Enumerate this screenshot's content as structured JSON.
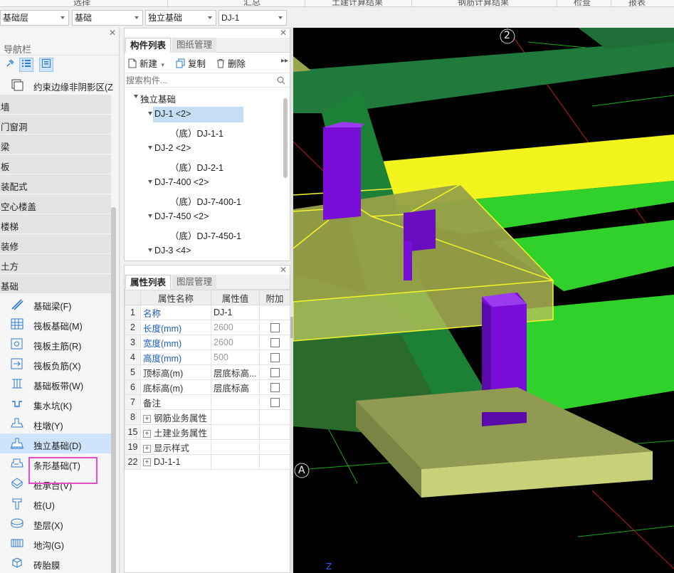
{
  "ribbon": {
    "items": [
      "选择",
      "汇总",
      "土建计算结果",
      "钢筋计算结果",
      "检查",
      "报表"
    ]
  },
  "selectors": [
    {
      "value": "基础层"
    },
    {
      "value": "基础"
    },
    {
      "value": "独立基础"
    },
    {
      "value": "DJ-1"
    }
  ],
  "nav": {
    "title": "导航栏",
    "items": [
      {
        "kind": "item",
        "label": "约束边缘非阴影区(Z",
        "icon": "wall-edge-icon"
      },
      {
        "kind": "cat",
        "label": "墙"
      },
      {
        "kind": "cat",
        "label": "门窗洞"
      },
      {
        "kind": "cat",
        "label": "梁"
      },
      {
        "kind": "cat",
        "label": "板"
      },
      {
        "kind": "cat",
        "label": "装配式"
      },
      {
        "kind": "cat",
        "label": "空心楼盖"
      },
      {
        "kind": "cat",
        "label": "楼梯"
      },
      {
        "kind": "cat",
        "label": "装修"
      },
      {
        "kind": "cat",
        "label": "土方"
      },
      {
        "kind": "cat",
        "label": "基础"
      },
      {
        "kind": "item",
        "label": "基础梁(F)",
        "icon": "foundation-beam-icon"
      },
      {
        "kind": "item",
        "label": "筏板基础(M)",
        "icon": "raft-foundation-icon"
      },
      {
        "kind": "item",
        "label": "筏板主筋(R)",
        "icon": "raft-main-rebar-icon"
      },
      {
        "kind": "item",
        "label": "筏板负筋(X)",
        "icon": "raft-negative-rebar-icon"
      },
      {
        "kind": "item",
        "label": "基础板带(W)",
        "icon": "foundation-strip-icon"
      },
      {
        "kind": "item",
        "label": "集水坑(K)",
        "icon": "sump-pit-icon"
      },
      {
        "kind": "item",
        "label": "柱墩(Y)",
        "icon": "column-pier-icon"
      },
      {
        "kind": "item",
        "label": "独立基础(D)",
        "icon": "isolated-footing-icon",
        "selected": true
      },
      {
        "kind": "item",
        "label": "条形基础(T)",
        "icon": "strip-footing-icon"
      },
      {
        "kind": "item",
        "label": "桩承台(V)",
        "icon": "pile-cap-icon"
      },
      {
        "kind": "item",
        "label": "桩(U)",
        "icon": "pile-icon"
      },
      {
        "kind": "item",
        "label": "垫层(X)",
        "icon": "cushion-icon"
      },
      {
        "kind": "item",
        "label": "地沟(G)",
        "icon": "trench-icon"
      },
      {
        "kind": "item",
        "label": "砖胎膜",
        "icon": "brick-mold-icon"
      }
    ]
  },
  "component_panel": {
    "tabs": [
      "构件列表",
      "图纸管理"
    ],
    "toolbar": {
      "new_label": "新建",
      "copy_label": "复制",
      "delete_label": "删除"
    },
    "search_placeholder": "搜索构件...",
    "tree": [
      {
        "level": 0,
        "label": "独立基础",
        "expanded": true
      },
      {
        "level": 1,
        "label": "DJ-1 <2>",
        "expanded": true,
        "selected": true
      },
      {
        "level": 2,
        "label": "（底）DJ-1-1"
      },
      {
        "level": 1,
        "label": "DJ-2 <2>",
        "expanded": true
      },
      {
        "level": 2,
        "label": "（底）DJ-2-1"
      },
      {
        "level": 1,
        "label": "DJ-7-400 <2>",
        "expanded": true
      },
      {
        "level": 2,
        "label": "（底）DJ-7-400-1"
      },
      {
        "level": 1,
        "label": "DJ-7-450 <2>",
        "expanded": true
      },
      {
        "level": 2,
        "label": "（底）DJ-7-450-1"
      },
      {
        "level": 1,
        "label": "DJ-3 <4>",
        "expanded": true
      }
    ]
  },
  "property_panel": {
    "tabs": [
      "属性列表",
      "图层管理"
    ],
    "columns": [
      "属性名称",
      "属性值",
      "附加"
    ],
    "rows": [
      {
        "num": "1",
        "name": "名称",
        "value": "DJ-1",
        "blue": true,
        "grey": false,
        "check": false,
        "group": false
      },
      {
        "num": "2",
        "name": "长度(mm)",
        "value": "2600",
        "blue": true,
        "grey": true,
        "check": true,
        "group": false
      },
      {
        "num": "3",
        "name": "宽度(mm)",
        "value": "2600",
        "blue": true,
        "grey": true,
        "check": true,
        "group": false
      },
      {
        "num": "4",
        "name": "高度(mm)",
        "value": "500",
        "blue": true,
        "grey": true,
        "check": true,
        "group": false
      },
      {
        "num": "5",
        "name": "顶标高(m)",
        "value": "层底标高...",
        "blue": false,
        "grey": false,
        "check": true,
        "group": false
      },
      {
        "num": "6",
        "name": "底标高(m)",
        "value": "层底标高",
        "blue": false,
        "grey": false,
        "check": true,
        "group": false
      },
      {
        "num": "7",
        "name": "备注",
        "value": "",
        "blue": false,
        "grey": false,
        "check": true,
        "group": false
      },
      {
        "num": "8",
        "name": "钢筋业务属性",
        "value": "",
        "group": true
      },
      {
        "num": "15",
        "name": "土建业务属性",
        "value": "",
        "group": true
      },
      {
        "num": "19",
        "name": "显示样式",
        "value": "",
        "group": true
      },
      {
        "num": "22",
        "name": "DJ-1-1",
        "value": "",
        "group": true
      }
    ]
  },
  "viewport": {
    "axis_labels": [
      "2",
      "A"
    ],
    "axis_indicator": "Z",
    "colors": {
      "background": "#000000",
      "beam_green": "#2fd12a",
      "beam_dark_green": "#1f7a3c",
      "slab_yellow": "#f2f21c",
      "column_purple": "#7a0ed9",
      "footing_olive": "#c8d078",
      "selection_yellow": "#f5f52a",
      "grid_red": "#c01818",
      "grid_green": "#17a817"
    }
  }
}
